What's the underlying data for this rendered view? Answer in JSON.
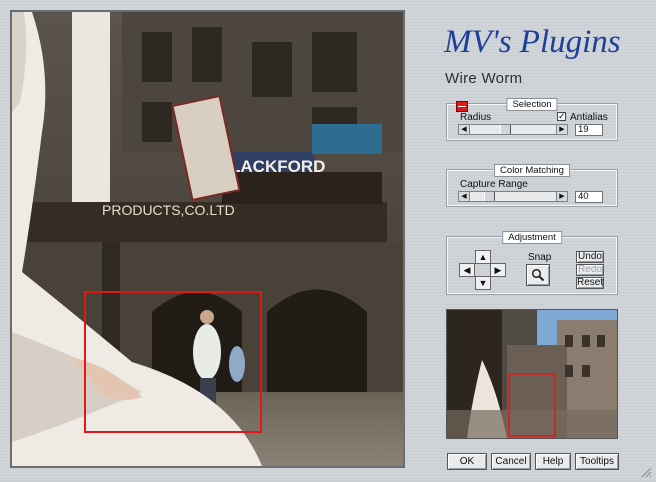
{
  "brand": {
    "logo_text": "MV's Plugins"
  },
  "plugin": {
    "title": "Wire Worm"
  },
  "selection": {
    "group_label": "Selection",
    "radius_label": "Radius",
    "radius_value": "19",
    "radius_level": 0.4,
    "antialias_label": "Antialias",
    "antialias_checked": true,
    "color_swatch": "#e01818"
  },
  "color_matching": {
    "group_label": "Color Matching",
    "capture_label": "Capture Range",
    "capture_value": "40",
    "capture_level": 0.2
  },
  "adjustment": {
    "group_label": "Adjustment",
    "snap_label": "Snap",
    "undo_label": "Undo",
    "redo_label": "Redo",
    "reset_label": "Reset"
  },
  "footer": {
    "ok_label": "OK",
    "cancel_label": "Cancel",
    "help_label": "Help",
    "tooltips_label": "Tooltips"
  },
  "icons": [
    "up-arrow-icon",
    "down-arrow-icon",
    "left-arrow-icon",
    "right-arrow-icon",
    "magnifier-icon",
    "resize-grip-icon"
  ],
  "colors": {
    "selection_rect": "#e01818",
    "accent_blue": "#1e3f9a"
  }
}
